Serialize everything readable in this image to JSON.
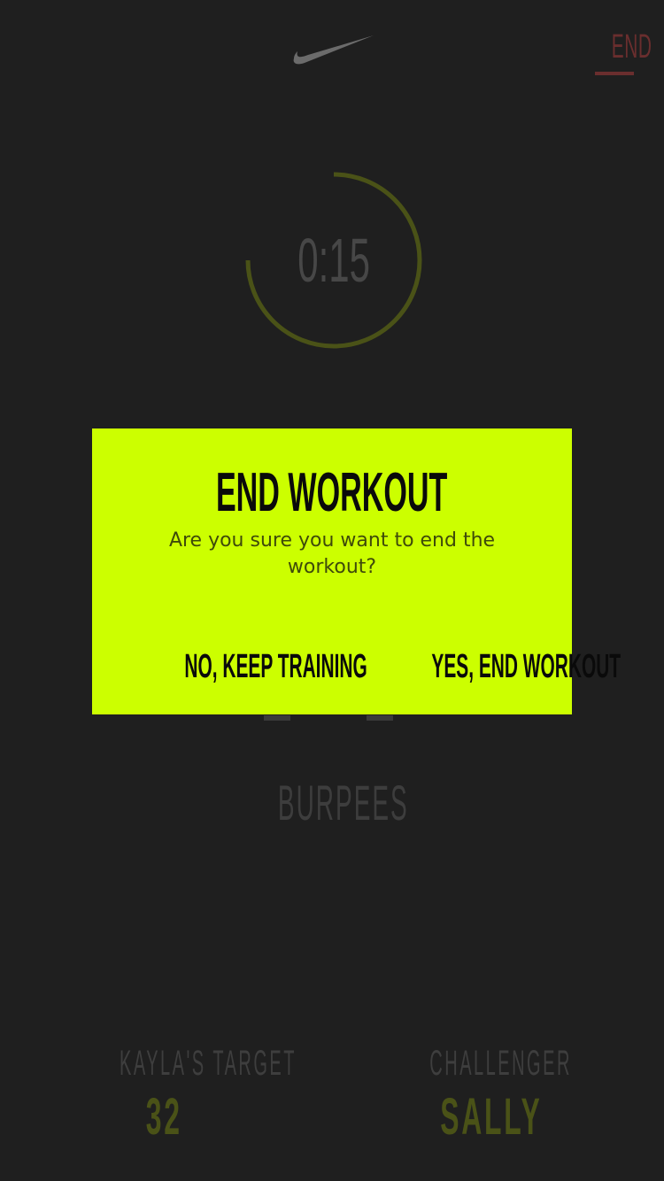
{
  "header": {
    "logo_icon": "nike-swoosh-icon",
    "end_label": "END"
  },
  "timer": {
    "display": "0:15",
    "progress_fraction": 0.75
  },
  "exercise": {
    "name": "BURPEES"
  },
  "stats": {
    "target_label": "KAYLA'S TARGET",
    "target_value": "32",
    "challenger_label": "CHALLENGER",
    "challenger_value": "SALLY"
  },
  "dialog": {
    "title": "END WORKOUT",
    "message": "Are you sure you want to end the workout?",
    "keep_label": "NO, KEEP TRAINING",
    "end_label": "YES, END WORKOUT"
  },
  "colors": {
    "background": "#1f1f1f",
    "accent_volt": "#ccff00",
    "ring": "#4a5217",
    "end_red": "#6a2e2e"
  }
}
